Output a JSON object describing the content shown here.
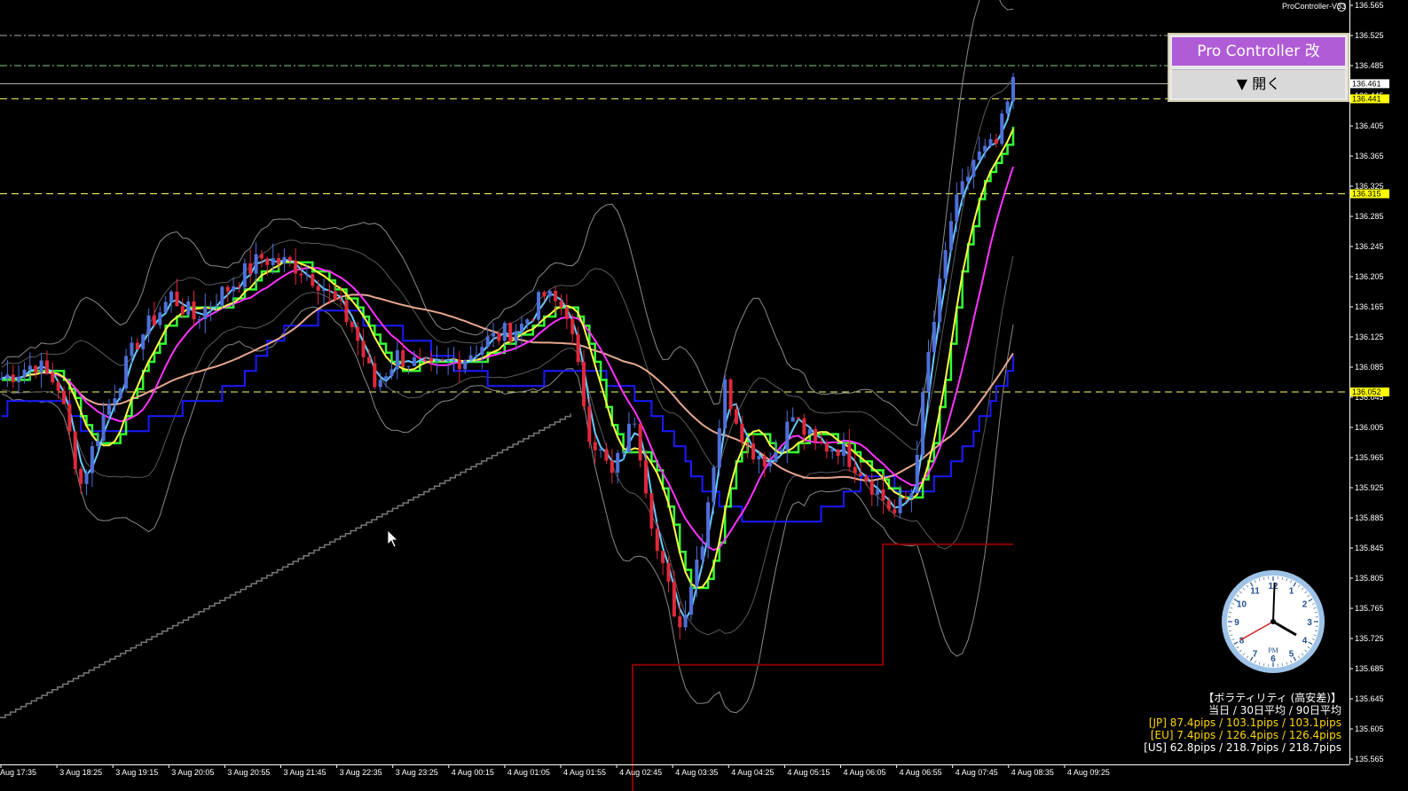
{
  "window": {
    "ea_name": "ProController-V33"
  },
  "pro_controller": {
    "title": "Pro Controller 改",
    "open_label": "▼ 開く"
  },
  "volatility": {
    "title": "【ボラティリティ (高安差)】",
    "subtitle": "当日 / 30日平均 / 90日平均",
    "rows": [
      {
        "text": "[JP] 87.4pips / 103.1pips / 103.1pips",
        "color": "#ffd700"
      },
      {
        "text": "[EU] 7.4pips / 126.4pips / 126.4pips",
        "color": "#ffd700"
      },
      {
        "text": "[US] 62.8pips / 218.7pips / 218.7pips",
        "color": "#ffffff"
      }
    ]
  },
  "clock": {
    "label": "PM",
    "hour": 4,
    "minute": 0,
    "second": 21
  },
  "chart_data": {
    "type": "candlestick",
    "y_ticks": [
      "136.565",
      "136.525",
      "136.485",
      "136.445",
      "136.405",
      "136.365",
      "136.325",
      "136.285",
      "136.245",
      "136.205",
      "136.165",
      "136.125",
      "136.085",
      "136.045",
      "136.005",
      "135.965",
      "135.925",
      "135.885",
      "135.845",
      "135.805",
      "135.765",
      "135.725",
      "135.685",
      "135.645",
      "135.605",
      "135.565"
    ],
    "ylim": [
      135.565,
      136.565
    ],
    "x_ticks": [
      "Aug 17:35",
      "3 Aug 18:25",
      "3 Aug 19:15",
      "3 Aug 20:05",
      "3 Aug 20:55",
      "3 Aug 21:45",
      "3 Aug 22:35",
      "3 Aug 23:25",
      "4 Aug 00:15",
      "4 Aug 01:05",
      "4 Aug 01:55",
      "4 Aug 02:45",
      "4 Aug 03:35",
      "4 Aug 04:25",
      "4 Aug 05:15",
      "4 Aug 06:05",
      "4 Aug 06:55",
      "4 Aug 07:45",
      "4 Aug 08:35",
      "4 Aug 09:25"
    ],
    "current_price": "136.461",
    "price_labels": [
      {
        "value": 136.441,
        "label": "136.441",
        "style": "dash",
        "color": "#ffff66",
        "label_bg": "#ffff00"
      },
      {
        "value": 136.315,
        "label": "136.315",
        "style": "dash",
        "color": "#ffff66",
        "label_bg": "#ffff00"
      },
      {
        "value": 136.052,
        "label": "136.052",
        "style": "dash",
        "color": "#ffff66",
        "label_bg": "#ffff00"
      }
    ],
    "extra_lines": [
      {
        "value": 136.525,
        "style": "dashdot",
        "color": "#aaaaaa"
      },
      {
        "value": 136.485,
        "style": "dashdot",
        "color": "#88cc88"
      }
    ]
  }
}
